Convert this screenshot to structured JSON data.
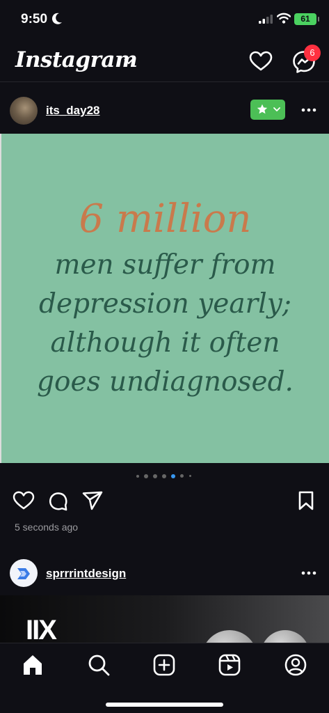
{
  "status_bar": {
    "time": "9:50",
    "battery": "61"
  },
  "header": {
    "logo": "Instagram",
    "notification_count": "6"
  },
  "post1": {
    "username": "its_day28",
    "image_text": {
      "highlight": "6 million",
      "lines": [
        "men suffer from",
        "depression yearly;",
        "although it often",
        "goes undiagnosed."
      ]
    },
    "carousel": {
      "total": 7,
      "active": 4
    },
    "timestamp": "5 seconds ago"
  },
  "post2": {
    "username": "sprrrintdesign",
    "image_text": "IIX"
  },
  "icons": {
    "status": [
      "moon-icon",
      "signal-icon",
      "wifi-icon",
      "battery-icon"
    ],
    "header": [
      "chevron-down-icon",
      "heart-icon",
      "messenger-icon"
    ],
    "post": [
      "heart-icon",
      "comment-icon",
      "share-icon",
      "bookmark-icon",
      "more-icon"
    ],
    "tabs": [
      "home-icon",
      "search-icon",
      "create-icon",
      "reels-icon",
      "profile-icon"
    ]
  },
  "colors": {
    "background": "#0f0f15",
    "post_bg": "#84c1a2",
    "highlight_text": "#c97a4c",
    "quote_text": "#2a5a4a",
    "favorite_badge": "#4cbf56",
    "notification_badge": "#ff3040",
    "active_dot": "#3897f0"
  }
}
